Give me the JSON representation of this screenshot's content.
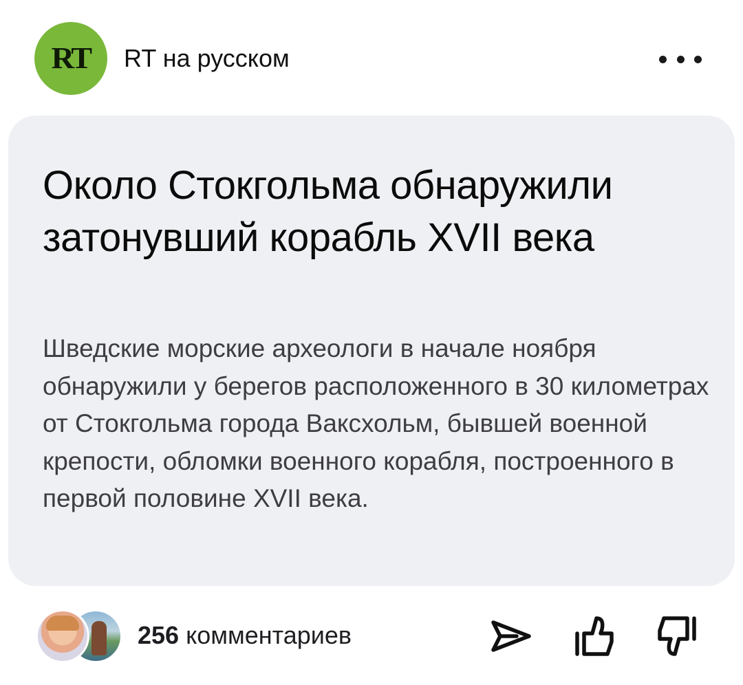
{
  "header": {
    "logo_text": "RT",
    "logo_color": "#7ab83a",
    "channel_name": "RT на русском",
    "more_icon": "more-dots-icon"
  },
  "article": {
    "title": "Около Стокгольма обнаружили затонувший корабль XVII века",
    "summary": "Шведские морские археологи в начале ноября обнаружили у берегов расположенного в 30 километрах от Стокгольма города Ваксхольм, бывшей военной крепости, обломки военного корабля, построенного в первой половине XVII века.",
    "card_background": "#eff0f4"
  },
  "footer": {
    "comments_number": "256",
    "comments_label": " комментариев",
    "actions": {
      "share_icon": "share-send-icon",
      "like_icon": "thumbs-up-icon",
      "dislike_icon": "thumbs-down-icon"
    }
  }
}
